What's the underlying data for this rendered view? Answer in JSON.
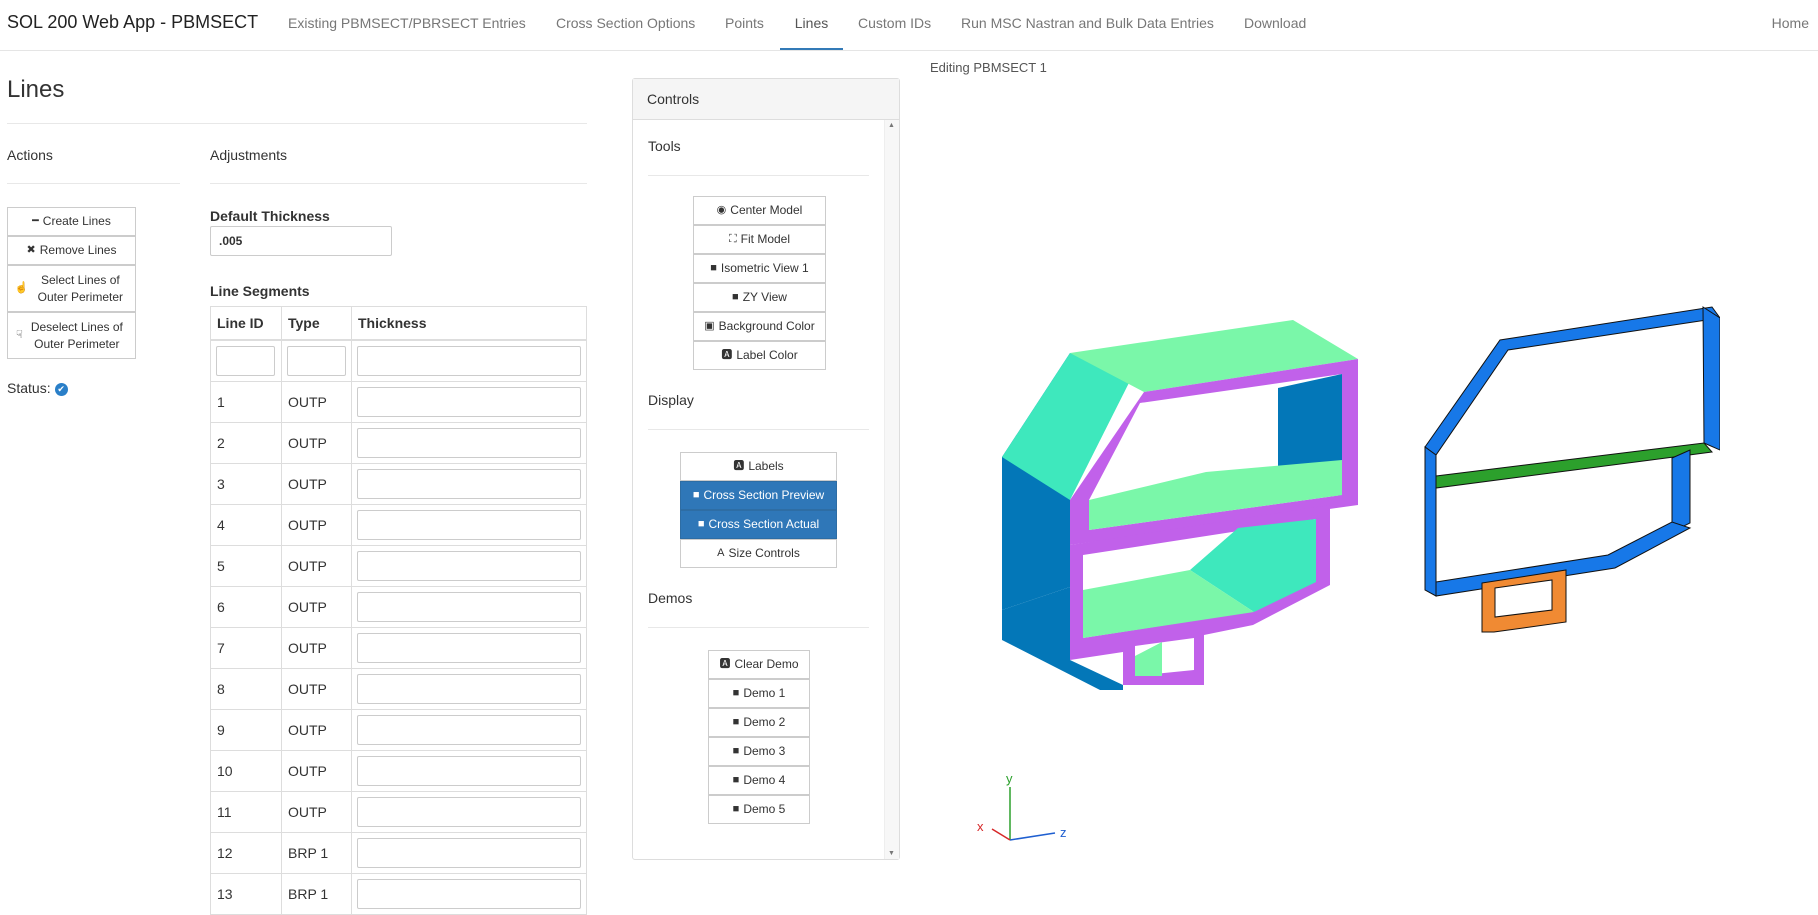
{
  "nav": {
    "brand": "SOL 200 Web App - PBMSECT",
    "items": [
      "Existing PBMSECT/PBRSECT Entries",
      "Cross Section Options",
      "Points",
      "Lines",
      "Custom IDs",
      "Run MSC Nastran and Bulk Data Entries",
      "Download"
    ],
    "active": "Lines",
    "home": "Home"
  },
  "page": {
    "title": "Lines",
    "editing": "Editing PBMSECT 1"
  },
  "actions": {
    "heading": "Actions",
    "create": "Create Lines",
    "remove": "Remove Lines",
    "select_outer": "Select Lines of Outer Perimeter",
    "deselect_outer": "Deselect Lines of Outer Perimeter",
    "status_label": "Status:"
  },
  "adjustments": {
    "heading": "Adjustments",
    "default_thickness_label": "Default Thickness",
    "default_thickness_value": ".005",
    "line_segments_label": "Line Segments",
    "columns": [
      "Line ID",
      "Type",
      "Thickness"
    ],
    "rows": [
      {
        "id": "1",
        "type": "OUTP"
      },
      {
        "id": "2",
        "type": "OUTP"
      },
      {
        "id": "3",
        "type": "OUTP"
      },
      {
        "id": "4",
        "type": "OUTP"
      },
      {
        "id": "5",
        "type": "OUTP"
      },
      {
        "id": "6",
        "type": "OUTP"
      },
      {
        "id": "7",
        "type": "OUTP"
      },
      {
        "id": "8",
        "type": "OUTP"
      },
      {
        "id": "9",
        "type": "OUTP"
      },
      {
        "id": "10",
        "type": "OUTP"
      },
      {
        "id": "11",
        "type": "OUTP"
      },
      {
        "id": "12",
        "type": "BRP 1"
      },
      {
        "id": "13",
        "type": "BRP 1"
      }
    ]
  },
  "controls": {
    "title": "Controls",
    "tools_heading": "Tools",
    "tools": [
      "Center Model",
      "Fit Model",
      "Isometric View 1",
      "ZY View",
      "Background Color",
      "Label Color"
    ],
    "display_heading": "Display",
    "display": [
      "Labels",
      "Cross Section Preview",
      "Cross Section Actual",
      "Size Controls"
    ],
    "demos_heading": "Demos",
    "demos": [
      "Clear Demo",
      "Demo 1",
      "Demo 2",
      "Demo 3",
      "Demo 4",
      "Demo 5"
    ]
  },
  "viewer": {
    "axes": {
      "x": "x",
      "y": "y",
      "z": "z"
    },
    "colors": {
      "face_light": "#7af7a9",
      "face_mid": "#3ee8bd",
      "face_dark": "#0377b8",
      "edge_purple": "#c161ea",
      "wire_blue": "#1778e8",
      "wire_green": "#2ca02c",
      "wire_orange": "#f08a33"
    }
  }
}
